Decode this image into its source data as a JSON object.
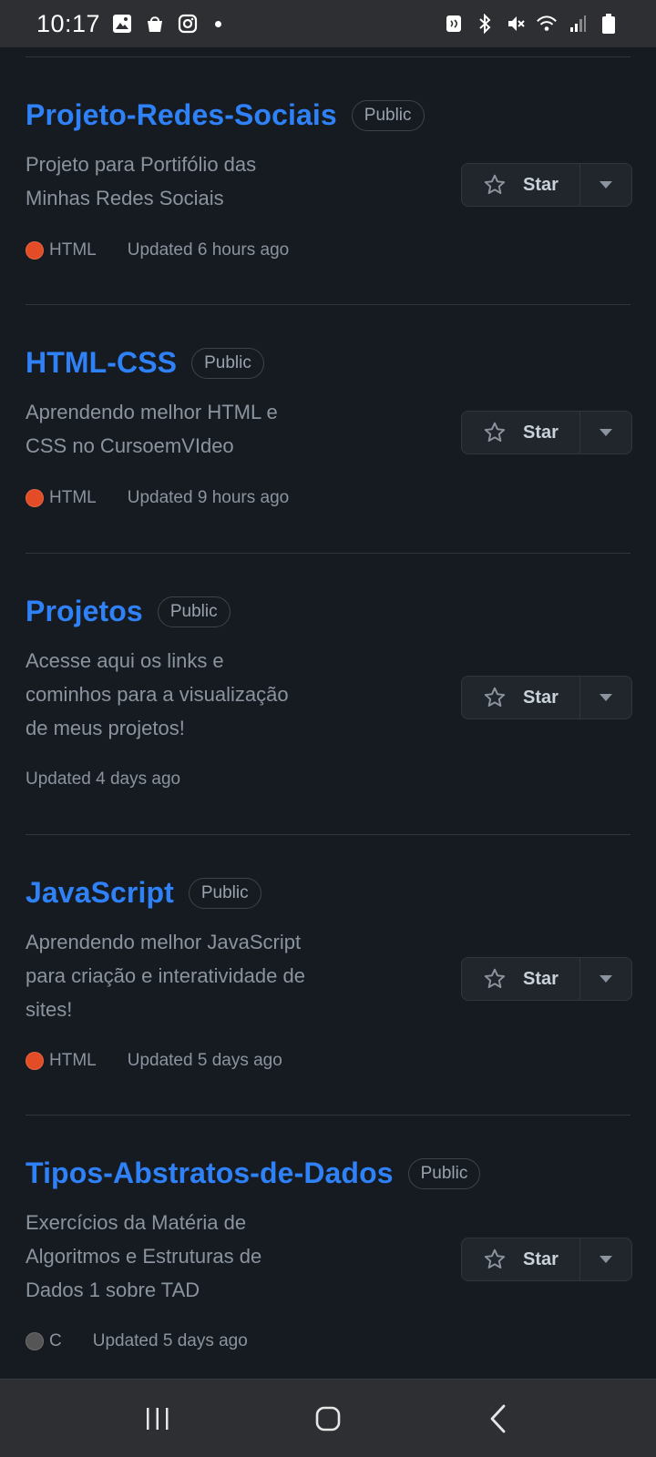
{
  "status_bar": {
    "time": "10:17",
    "icons_left": [
      "gallery-icon",
      "shopping-bag-icon",
      "instagram-icon",
      "notification-dot"
    ],
    "icons_right": [
      "nfc-icon",
      "bluetooth-icon",
      "mute-icon",
      "wifi-icon",
      "signal-icon",
      "battery-icon"
    ]
  },
  "colors": {
    "background": "#161b22",
    "link": "#2f81f7",
    "muted": "#8b949e",
    "html_lang": "#e34c26",
    "c_lang": "#555555"
  },
  "repos": [
    {
      "name": "Projeto-Redes-Sociais",
      "visibility": "Public",
      "description_lines": [
        "Projeto para Portifólio das",
        "Minhas Redes Sociais"
      ],
      "language": "HTML",
      "language_color": "#e34c26",
      "updated": "Updated 6 hours ago",
      "star_label": "Star"
    },
    {
      "name": "HTML-CSS",
      "visibility": "Public",
      "description_lines": [
        "Aprendendo melhor HTML e",
        "CSS no CursoemVIdeo"
      ],
      "language": "HTML",
      "language_color": "#e34c26",
      "updated": "Updated 9 hours ago",
      "star_label": "Star"
    },
    {
      "name": "Projetos",
      "visibility": "Public",
      "description_lines": [
        "Acesse aqui os links e",
        "cominhos para a visualização",
        "de meus projetos!"
      ],
      "language": null,
      "language_color": null,
      "updated": "Updated 4 days ago",
      "star_label": "Star"
    },
    {
      "name": "JavaScript",
      "visibility": "Public",
      "description_lines": [
        "Aprendendo melhor JavaScript",
        "para criação e interatividade de",
        "sites!"
      ],
      "language": "HTML",
      "language_color": "#e34c26",
      "updated": "Updated 5 days ago",
      "star_label": "Star"
    },
    {
      "name": "Tipos-Abstratos-de-Dados",
      "visibility": "Public",
      "description_lines": [
        "Exercícios da Matéria de",
        "Algoritmos e Estruturas de",
        "Dados 1 sobre TAD"
      ],
      "language": "C",
      "language_color": "#555555",
      "updated": "Updated 5 days ago",
      "star_label": "Star"
    }
  ],
  "nav_bar": {
    "buttons": [
      "recent-apps-icon",
      "home-icon",
      "back-icon"
    ]
  }
}
